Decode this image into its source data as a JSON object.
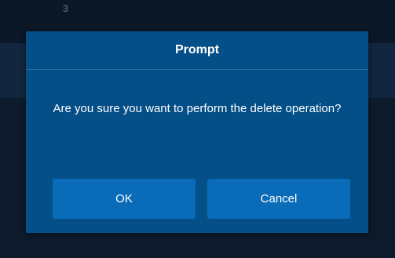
{
  "background": {
    "row_number": "3"
  },
  "dialog": {
    "title": "Prompt",
    "message": "Are you sure you want to perform the delete operation?",
    "ok_label": "OK",
    "cancel_label": "Cancel"
  },
  "colors": {
    "dialog_background": "#044f87",
    "button_background": "#0a6cb8",
    "page_background": "#0c1a2b"
  }
}
